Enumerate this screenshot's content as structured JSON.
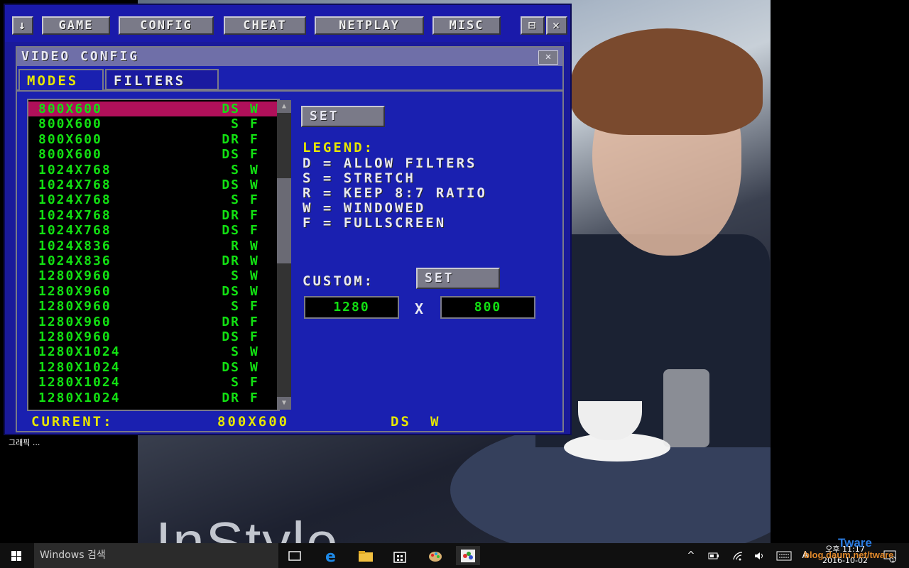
{
  "menu": {
    "items": [
      "↓",
      "GAME",
      "CONFIG",
      "CHEAT",
      "NETPLAY",
      "MISC"
    ],
    "restore_glyph": "⊟",
    "close_glyph": "✕"
  },
  "panel": {
    "title": "VIDEO CONFIG",
    "close_glyph": "✕",
    "tabs": [
      "MODES",
      "FILTERS"
    ],
    "active_tab": "MODES"
  },
  "modes": [
    {
      "res": "800X600",
      "f1": "DS",
      "f2": "W",
      "selected": true
    },
    {
      "res": "800X600",
      "f1": "S",
      "f2": "F"
    },
    {
      "res": "800X600",
      "f1": "DR",
      "f2": "F"
    },
    {
      "res": "800X600",
      "f1": "DS",
      "f2": "F"
    },
    {
      "res": "1024X768",
      "f1": "S",
      "f2": "W"
    },
    {
      "res": "1024X768",
      "f1": "DS",
      "f2": "W"
    },
    {
      "res": "1024X768",
      "f1": "S",
      "f2": "F"
    },
    {
      "res": "1024X768",
      "f1": "DR",
      "f2": "F"
    },
    {
      "res": "1024X768",
      "f1": "DS",
      "f2": "F"
    },
    {
      "res": "1024X836",
      "f1": "R",
      "f2": "W"
    },
    {
      "res": "1024X836",
      "f1": "DR",
      "f2": "W"
    },
    {
      "res": "1280X960",
      "f1": "S",
      "f2": "W"
    },
    {
      "res": "1280X960",
      "f1": "DS",
      "f2": "W"
    },
    {
      "res": "1280X960",
      "f1": "S",
      "f2": "F"
    },
    {
      "res": "1280X960",
      "f1": "DR",
      "f2": "F"
    },
    {
      "res": "1280X960",
      "f1": "DS",
      "f2": "F"
    },
    {
      "res": "1280X1024",
      "f1": "S",
      "f2": "W"
    },
    {
      "res": "1280X1024",
      "f1": "DS",
      "f2": "W"
    },
    {
      "res": "1280X1024",
      "f1": "S",
      "f2": "F"
    },
    {
      "res": "1280X1024",
      "f1": "DR",
      "f2": "F"
    }
  ],
  "set_label": "SET",
  "legend": {
    "title": "LEGEND:",
    "lines": [
      "D = ALLOW FILTERS",
      "S = STRETCH",
      "R = KEEP 8:7 RATIO",
      "W = WINDOWED",
      "F = FULLSCREEN"
    ]
  },
  "custom": {
    "label": "CUSTOM:",
    "set_label": "SET",
    "width": "1280",
    "separator": "X",
    "height": "800"
  },
  "current": {
    "label": "CURRENT:",
    "res": "800X600",
    "f1": "DS",
    "f2": "W"
  },
  "desktop": {
    "label": "그래픽 ...",
    "photo_brand": "InStyle"
  },
  "taskbar": {
    "search_placeholder": "Windows 검색",
    "clock_line1": "오후 11:17",
    "clock_line2": "2016-10-02",
    "ime": "A",
    "watermark_top": "Tware",
    "watermark_bottom": "blog.daum.net/tware",
    "notification_count": "1"
  }
}
